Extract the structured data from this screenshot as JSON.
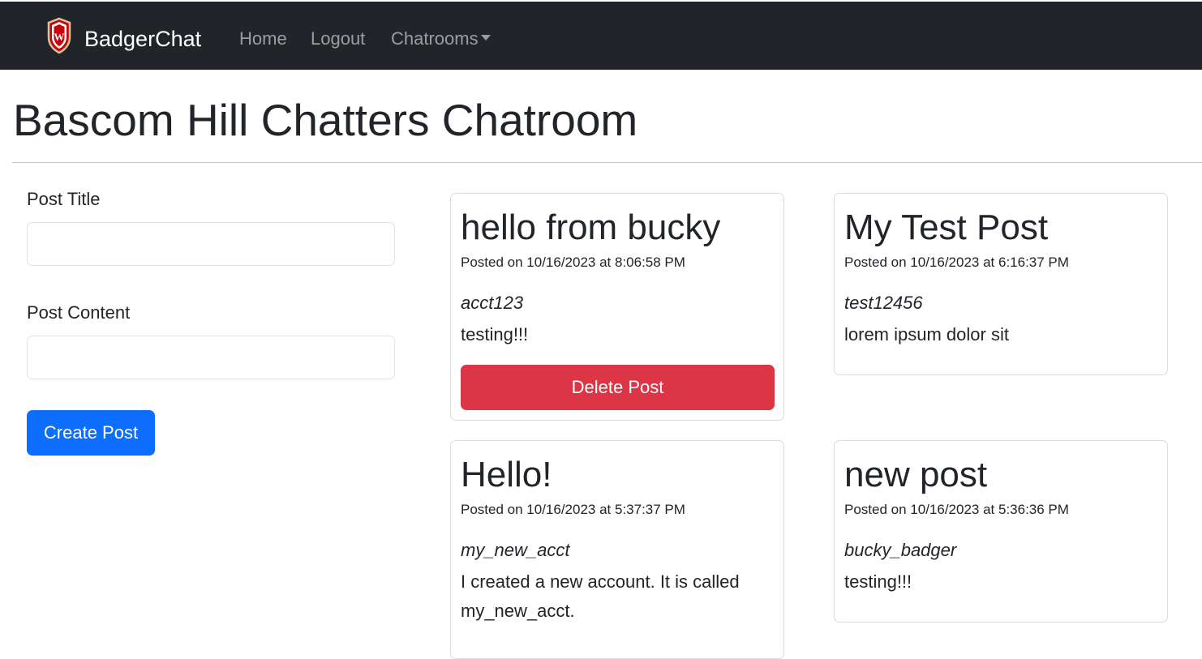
{
  "navbar": {
    "brand_name": "BadgerChat",
    "links": [
      {
        "label": "Home"
      },
      {
        "label": "Logout"
      },
      {
        "label": "Chatrooms"
      }
    ]
  },
  "page": {
    "title": "Bascom Hill Chatters Chatroom"
  },
  "form": {
    "title_label": "Post Title",
    "title_value": "",
    "content_label": "Post Content",
    "content_value": "",
    "submit_label": "Create Post"
  },
  "posts": [
    {
      "title": "hello from bucky",
      "date": "Posted on 10/16/2023 at 8:06:58 PM",
      "author": "acct123",
      "content": "testing!!!",
      "delete_label": "Delete Post"
    },
    {
      "title": "My Test Post",
      "date": "Posted on 10/16/2023 at 6:16:37 PM",
      "author": "test12456",
      "content": "lorem ipsum dolor sit"
    },
    {
      "title": "Hello!",
      "date": "Posted on 10/16/2023 at 5:37:37 PM",
      "author": "my_new_acct",
      "content": "I created a new account. It is called my_new_acct."
    },
    {
      "title": "new post",
      "date": "Posted on 10/16/2023 at 5:36:36 PM",
      "author": "bucky_badger",
      "content": "testing!!!"
    }
  ],
  "colors": {
    "navbar_bg": "#212529",
    "primary": "#0d6efd",
    "danger": "#dc3545"
  },
  "icons": {
    "brand_logo": "uw-crest-icon",
    "dropdown": "caret-down-icon"
  }
}
